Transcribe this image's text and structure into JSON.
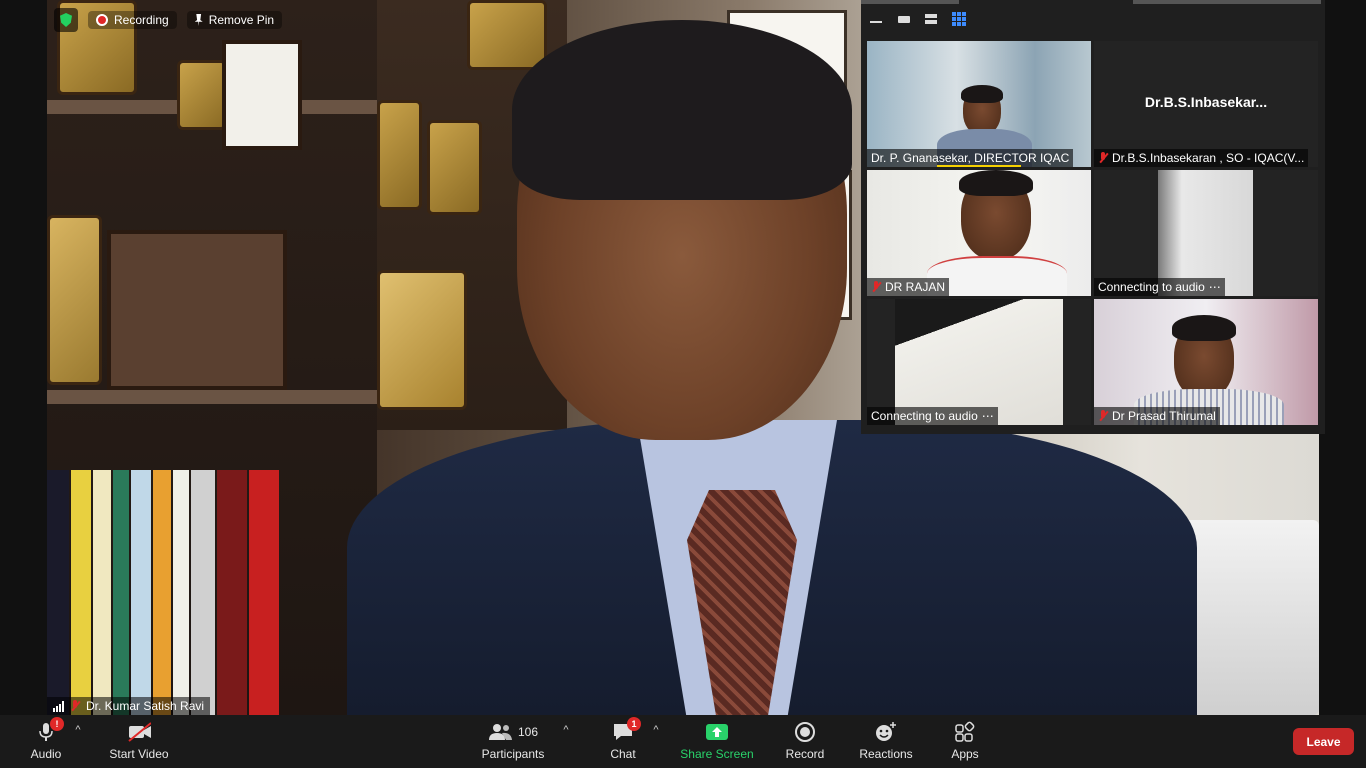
{
  "top_status": {
    "recording_label": "Recording",
    "remove_pin_label": "Remove Pin"
  },
  "main_video": {
    "participant_name": "Dr. Kumar Satish Ravi"
  },
  "gallery": {
    "tiles": [
      {
        "label": "Dr. P. Gnanasekar, DIRECTOR IQAC",
        "muted": false
      },
      {
        "display_name": "Dr.B.S.Inbasekar...",
        "label": "Dr.B.S.Inbasekaran , SO - IQAC(V...",
        "muted": true
      },
      {
        "label": "DR RAJAN",
        "muted": true
      },
      {
        "label": "Connecting to audio",
        "muted": false
      },
      {
        "label": "Connecting to audio",
        "muted": false
      },
      {
        "label": "Dr Prasad Thirumal",
        "muted": true
      }
    ]
  },
  "toolbar": {
    "audio_label": "Audio",
    "audio_badge": "!",
    "video_label": "Start Video",
    "participants_label": "Participants",
    "participants_count": "106",
    "chat_label": "Chat",
    "chat_badge": "1",
    "share_label": "Share Screen",
    "record_label": "Record",
    "reactions_label": "Reactions",
    "apps_label": "Apps",
    "leave_label": "Leave"
  },
  "colors": {
    "leave_red": "#c62828",
    "share_green": "#29d26a",
    "badge_red": "#e02828",
    "active_speaker": "#f5d000"
  }
}
